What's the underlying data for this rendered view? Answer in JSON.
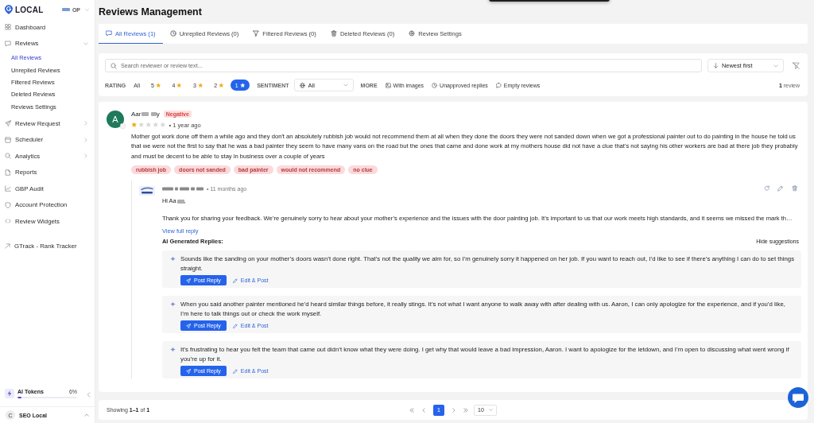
{
  "sidebar": {
    "brand": "LOCAL",
    "account": "OP",
    "items": [
      {
        "label": "Dashboard",
        "kind": "link",
        "selected": false
      },
      {
        "label": "Reviews",
        "kind": "group",
        "expanded": true,
        "selected": false,
        "children": [
          {
            "label": "All Reviews",
            "selected": true
          },
          {
            "label": "Unreplied Reviews",
            "selected": false
          },
          {
            "label": "Filtered Reviews",
            "selected": false
          },
          {
            "label": "Deleted Reviews",
            "selected": false
          },
          {
            "label": "Reviews Settings",
            "selected": false
          }
        ]
      },
      {
        "label": "Review Request",
        "kind": "group",
        "expanded": false,
        "selected": false
      },
      {
        "label": "Scheduler",
        "kind": "group",
        "expanded": false,
        "selected": false
      },
      {
        "label": "Analytics",
        "kind": "group",
        "expanded": false,
        "selected": false
      },
      {
        "label": "Reports",
        "kind": "link",
        "selected": false
      },
      {
        "label": "GBP Audit",
        "kind": "link",
        "selected": false
      },
      {
        "label": "Account Protection",
        "kind": "link",
        "selected": false
      },
      {
        "label": "Review Widgets",
        "kind": "link",
        "selected": false
      }
    ],
    "external_link": "GTrack - Rank Tracker",
    "tokens": {
      "label": "AI Tokens",
      "value": "6%",
      "level": 0.06
    },
    "workspace": {
      "initial": "C",
      "name": "SEO Local"
    }
  },
  "page_title": "Reviews Management",
  "tabs": [
    {
      "label": "All Reviews (1)",
      "selected": true
    },
    {
      "label": "Unreplied Reviews (0)",
      "selected": false
    },
    {
      "label": "Filtered Reviews (0)",
      "selected": false
    },
    {
      "label": "Deleted Reviews (0)",
      "selected": false
    },
    {
      "label": "Review Settings",
      "selected": false
    }
  ],
  "filters": {
    "search": {
      "placeholder": "Search reviewer or review text..."
    },
    "sort": {
      "value": "Newest first"
    },
    "rating": {
      "label": "RATING",
      "options": [
        {
          "label": "All",
          "kind": "text",
          "selected": false
        },
        {
          "label": "5",
          "kind": "star",
          "selected": false
        },
        {
          "label": "4",
          "kind": "star",
          "selected": false
        },
        {
          "label": "3",
          "kind": "star",
          "selected": false
        },
        {
          "label": "2",
          "kind": "star",
          "selected": false
        },
        {
          "label": "1",
          "kind": "star",
          "selected": true
        }
      ]
    },
    "sentiment": {
      "label": "SENTIMENT",
      "value": "All"
    },
    "more": {
      "label": "MORE",
      "options": [
        "With images",
        "Unapproved replies",
        "Empty reviews"
      ]
    },
    "count": "**1** review"
  },
  "review": {
    "avatar_letter": "A",
    "name_start": "Aar",
    "name_end": "y",
    "sentiment": "Negative",
    "stars": 1,
    "time": "• 1 year ago",
    "text": "Mother got work done off them a while ago and they don't an absolutely rubbish job would not recommend them at all when they done the doors they were not sanded down when we got a professional painter out to do painting in the house he told us that we were not the first to say that he was a bad painter they seem to have many vans on the road but the ones that came and done work at my mothers house did not have a clue that's not saying his other workers are bad at there job they probably and must be decent to be able to stay in business over a couple of years",
    "tags": [
      "rubbish job",
      "doors not sanded",
      "bad painter",
      "would not recommend",
      "no clue"
    ],
    "reply": {
      "time": "• 11 months ago",
      "greeting_start": "Hi Aa",
      "greeting_end": ",",
      "text": "Thank you for sharing your feedback. We’re genuinely sorry to hear about your mother’s experience and the issues with the door painting job. It’s important to us that our work meets high standards, and it seems we missed the mark th…",
      "link": "View full reply"
    },
    "ai": {
      "title": "AI Generated Replies:",
      "toggle": "Hide suggestions",
      "suggestions": [
        {
          "text": "Sounds like the sanding on your mother’s doors wasn’t done right. That’s not the quality we aim for, so I’m genuinely sorry it happened on her job. If you want to reach out, I’d like to see if there’s anything I can do to set things straight.",
          "post": "Post Reply",
          "edit": "Edit & Post"
        },
        {
          "text": "When you said another painter mentioned he’d heard similar things before, it really stings. It’s not what I want anyone to walk away with after dealing with us. Aaron, I can only apologize for the experience, and if you’d like, I’m here to talk things out or check the work myself.",
          "post": "Post Reply",
          "edit": "Edit & Post"
        },
        {
          "text": "It’s frustrating to hear you felt the team that came out didn’t know what they were doing. I get why that would leave a bad impression, Aaron. I want to apologize for the letdown, and I’m open to discussing what went wrong if you’re up for it.",
          "post": "Post Reply",
          "edit": "Edit & Post"
        }
      ]
    }
  },
  "pagination": {
    "summary": "Showing **1–1** of **1**",
    "pages": [
      {
        "label": "1",
        "selected": true
      }
    ],
    "page_size": "10"
  }
}
